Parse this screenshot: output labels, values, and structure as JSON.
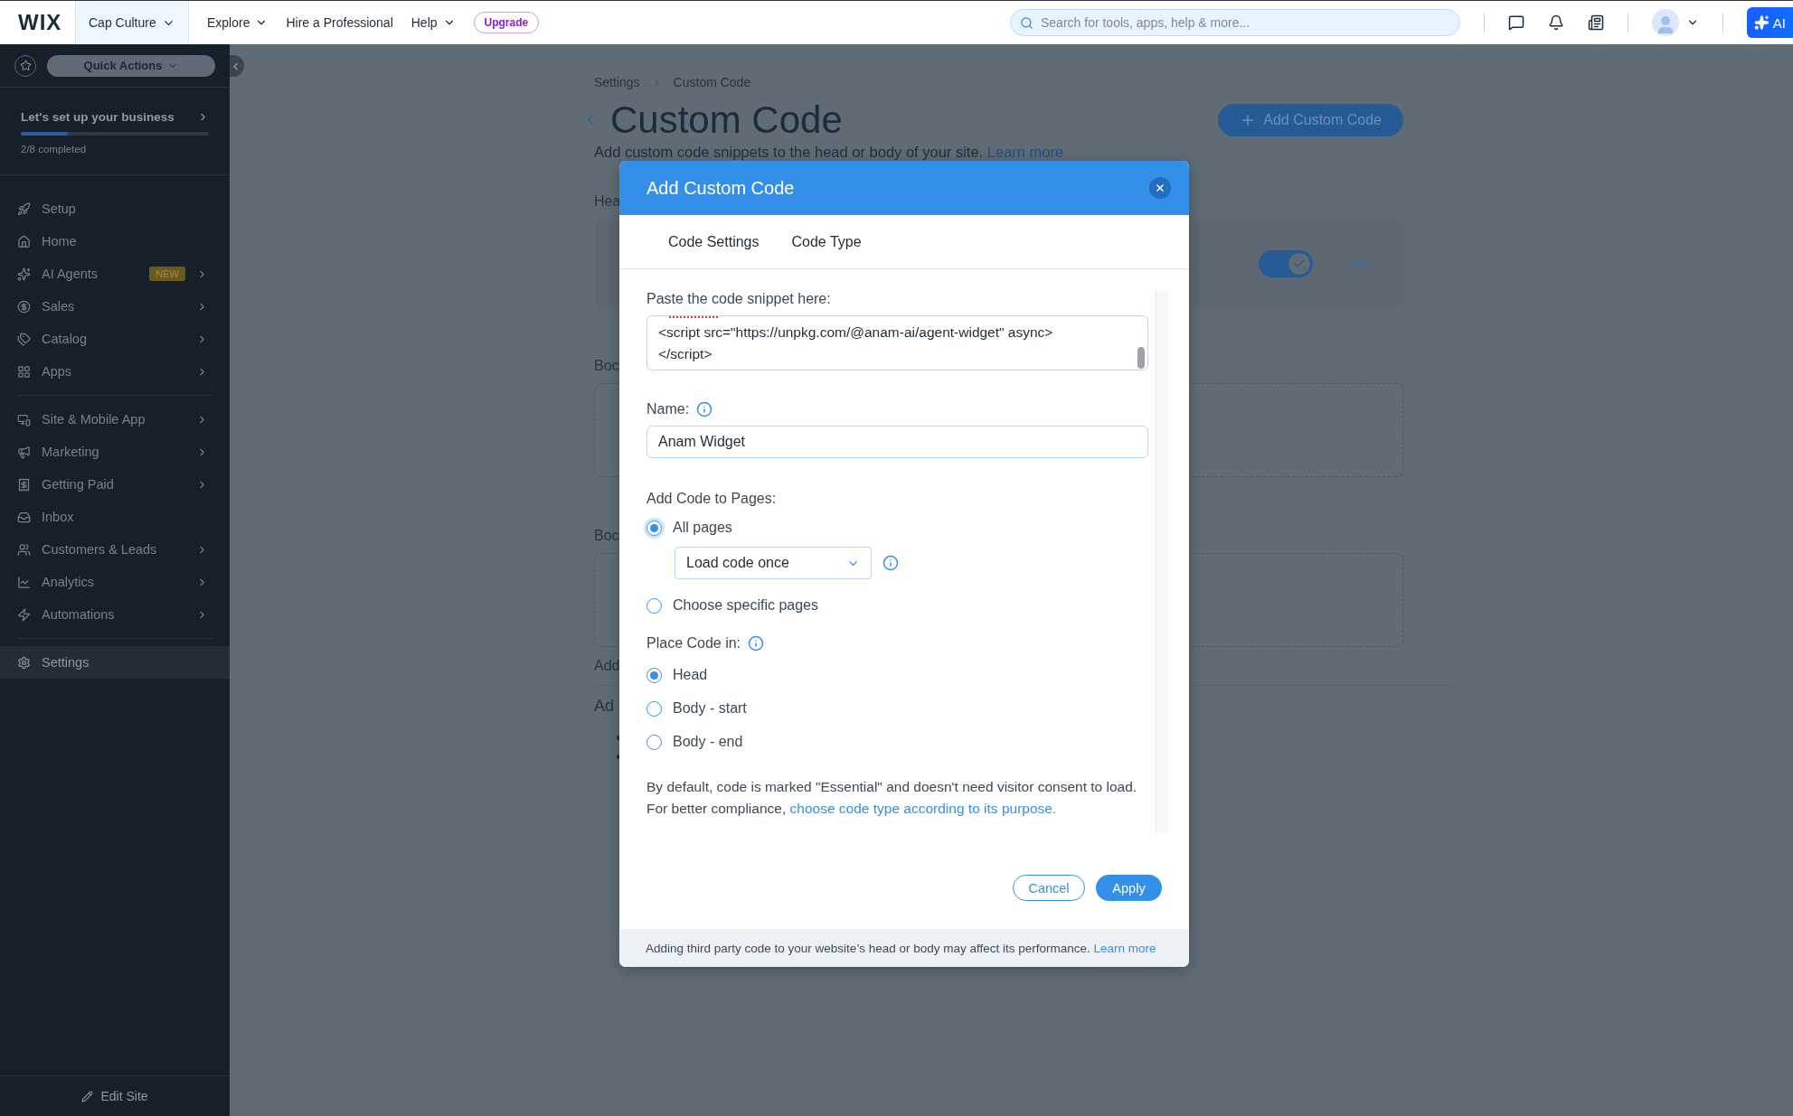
{
  "topbar": {
    "logo": "WIX",
    "site": "Cap Culture",
    "menu": [
      {
        "label": "Explore",
        "dropdown": true
      },
      {
        "label": "Hire a Professional",
        "dropdown": false
      },
      {
        "label": "Help",
        "dropdown": true
      }
    ],
    "upgrade": "Upgrade",
    "search": {
      "placeholder": "Search for tools, apps, help & more..."
    },
    "ai": "AI"
  },
  "sidebar": {
    "quick_actions": "Quick Actions",
    "setup": {
      "title": "Let's set up your business",
      "level": 0.25,
      "progress": "2/8 completed"
    },
    "groups": [
      [
        {
          "label": "Setup",
          "arrow": false,
          "selected": false
        },
        {
          "label": "Home",
          "arrow": false,
          "selected": false
        },
        {
          "label": "AI Agents",
          "arrow": true,
          "badge": "NEW",
          "selected": false
        },
        {
          "label": "Sales",
          "arrow": true,
          "selected": false
        },
        {
          "label": "Catalog",
          "arrow": true,
          "selected": false
        },
        {
          "label": "Apps",
          "arrow": true,
          "selected": false
        }
      ],
      [
        {
          "label": "Site & Mobile App",
          "arrow": true,
          "selected": false
        },
        {
          "label": "Marketing",
          "arrow": true,
          "selected": false
        },
        {
          "label": "Getting Paid",
          "arrow": true,
          "selected": false
        },
        {
          "label": "Inbox",
          "arrow": false,
          "selected": false
        },
        {
          "label": "Customers & Leads",
          "arrow": true,
          "selected": false
        },
        {
          "label": "Analytics",
          "arrow": true,
          "selected": false
        },
        {
          "label": "Automations",
          "arrow": true,
          "selected": false
        }
      ],
      [
        {
          "label": "Settings",
          "arrow": false,
          "selected": true
        }
      ]
    ],
    "edit_site": "Edit Site"
  },
  "page": {
    "breadcrumb": [
      "Settings",
      "Custom Code"
    ],
    "title": "Custom Code",
    "subtitle": "Add custom code snippets to the head or body of your site.",
    "subtitle_link": "Learn more",
    "add_button": "Add Custom Code",
    "sections": [
      "Hea",
      "Boc",
      "Boc"
    ],
    "head_card": {
      "toggle_on": true
    },
    "footnote": "Add",
    "heading": "Ad"
  },
  "modal": {
    "title": "Add Custom Code",
    "tabs": [
      "Code Settings",
      "Code Type"
    ],
    "snippet": {
      "label": "Paste the code snippet here:",
      "lines": [
        "<script src=\"https://unpkg.com/@anam-ai/agent-widget\" async>",
        "</script>"
      ]
    },
    "name": {
      "label": "Name:",
      "value": "Anam Widget"
    },
    "pages": {
      "label": "Add Code to Pages:",
      "options": [
        {
          "label": "All pages",
          "selected": true
        },
        {
          "label": "Choose specific pages",
          "selected": false
        }
      ],
      "load": "Load code once"
    },
    "place": {
      "label": "Place Code in:",
      "options": [
        {
          "label": "Head",
          "selected": true
        },
        {
          "label": "Body - start",
          "selected": false
        },
        {
          "label": "Body - end",
          "selected": false
        }
      ]
    },
    "notice": {
      "lines": [
        "By default, code is marked \"Essential\" and doesn't need visitor consent to load.",
        "For better compliance,"
      ],
      "link": "choose code type according to its purpose."
    },
    "buttons": {
      "cancel": "Cancel",
      "apply": "Apply"
    },
    "footer": {
      "text": "Adding third party code to your website’s head or body may affect its performance.",
      "link": "Learn more"
    }
  }
}
